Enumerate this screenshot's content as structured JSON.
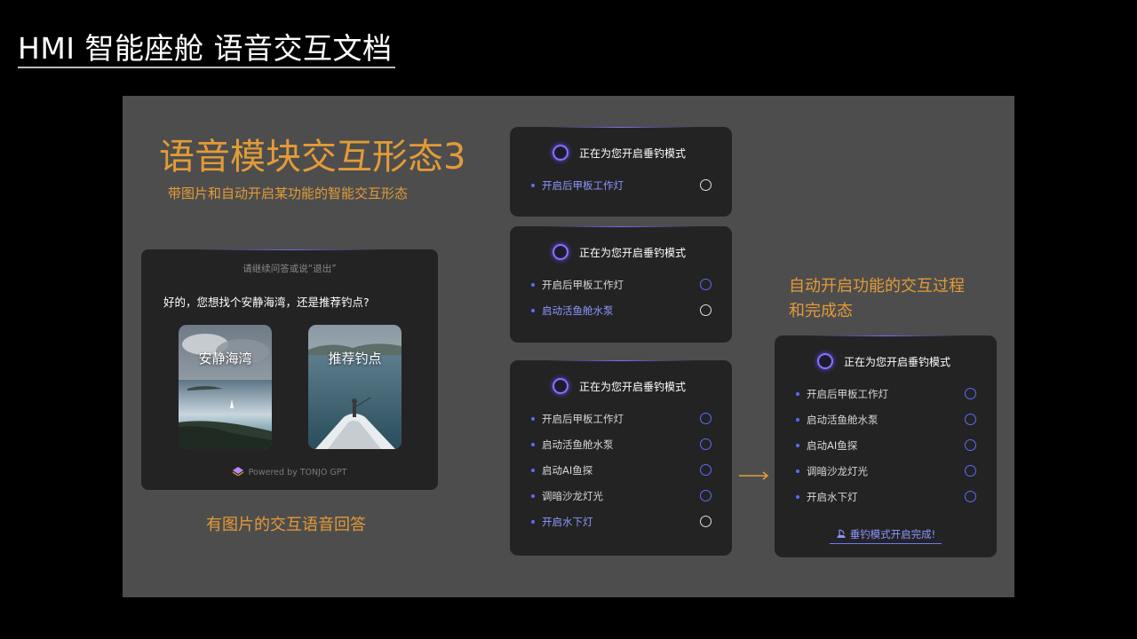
{
  "header": {
    "title": "HMI 智能座舱 语音交互文档"
  },
  "slide": {
    "heading": "语音模块交互形态3",
    "subheading": "带图片和自动开启某功能的智能交互形态",
    "caption_left": "有图片的交互语音回答",
    "caption_right_line1": "自动开启功能的交互过程",
    "caption_right_line2": "和完成态"
  },
  "answer_card": {
    "hint": "请继续问答或说“退出”",
    "reply": "好的，您想找个安静海湾，还是推荐钓点?",
    "options": [
      "安静海湾",
      "推荐钓点"
    ],
    "powered_by": "Powered by TONJO GPT"
  },
  "panels": [
    {
      "title": "正在为您开启垂钓模式",
      "items": [
        {
          "label": "开启后甲板工作灯",
          "state": "active"
        }
      ]
    },
    {
      "title": "正在为您开启垂钓模式",
      "items": [
        {
          "label": "开启后甲板工作灯",
          "state": "done"
        },
        {
          "label": "启动活鱼舱水泵",
          "state": "active"
        }
      ]
    },
    {
      "title": "正在为您开启垂钓模式",
      "items": [
        {
          "label": "开启后甲板工作灯",
          "state": "done"
        },
        {
          "label": "启动活鱼舱水泵",
          "state": "done"
        },
        {
          "label": "启动AI鱼探",
          "state": "done"
        },
        {
          "label": "调暗沙龙灯光",
          "state": "done"
        },
        {
          "label": "开启水下灯",
          "state": "active"
        }
      ]
    },
    {
      "title": "正在为您开启垂钓模式",
      "items": [
        {
          "label": "开启后甲板工作灯",
          "state": "done"
        },
        {
          "label": "启动活鱼舱水泵",
          "state": "done"
        },
        {
          "label": "启动AI鱼探",
          "state": "done"
        },
        {
          "label": "调暗沙龙灯光",
          "state": "done"
        },
        {
          "label": "开启水下灯",
          "state": "done"
        }
      ],
      "completion": "垂钓模式开启完成!"
    }
  ],
  "icons": {
    "status_orb": "voice-assistant-orb-icon",
    "done": "fishing-icon",
    "arrow": "arrow-right-icon",
    "logo": "tonjo-logo-icon"
  },
  "colors": {
    "accent_orange": "#e39b37",
    "accent_blue": "#5b6cff",
    "active_text": "#8c96ff",
    "card_bg": "#232323",
    "stage_bg": "#4d4d4d"
  }
}
